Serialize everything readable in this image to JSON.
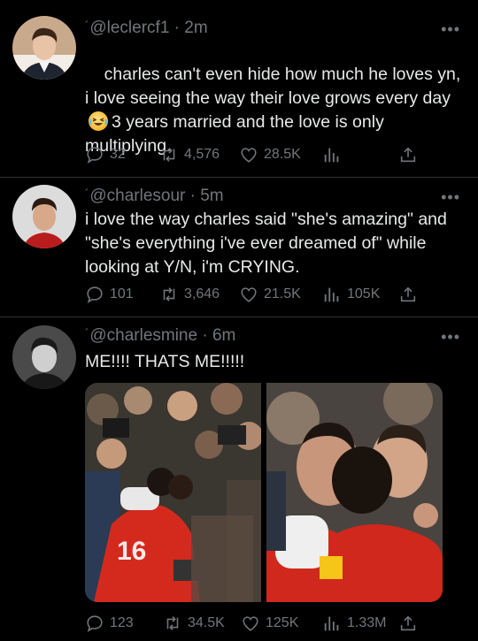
{
  "tweets": [
    {
      "handle": "@leclercf1",
      "time": "2m",
      "text_before_emoji": "charles can't even hide how much he loves yn, i love seeing the way their love grows every day",
      "emoji": "grinning-squinting-face-emoji",
      "text_after_emoji": "3 years married and the love is only multiplying.",
      "replies": "32",
      "retweets": "4,576",
      "likes": "28.5K",
      "views": ""
    },
    {
      "handle": "@charlesour",
      "time": "5m",
      "text": "i love the way charles said \"she's amazing\" and \"she's everything i've ever dreamed of\" while looking at Y/N, i'm CRYING.",
      "replies": "101",
      "retweets": "3,646",
      "likes": "21.5K",
      "views": "105K"
    },
    {
      "handle": "@charlesmine",
      "time": "6m",
      "text": "ME!!!! THATS ME!!!!!",
      "replies": "123",
      "retweets": "34.5K",
      "likes": "125K",
      "views": "1.33M"
    }
  ],
  "ui": {
    "more_glyph": "•••",
    "separator": "·",
    "tick": "´"
  },
  "colors": {
    "background": "#000000",
    "text": "#e7e9ea",
    "muted": "#71767b",
    "divider": "#2f3336"
  }
}
